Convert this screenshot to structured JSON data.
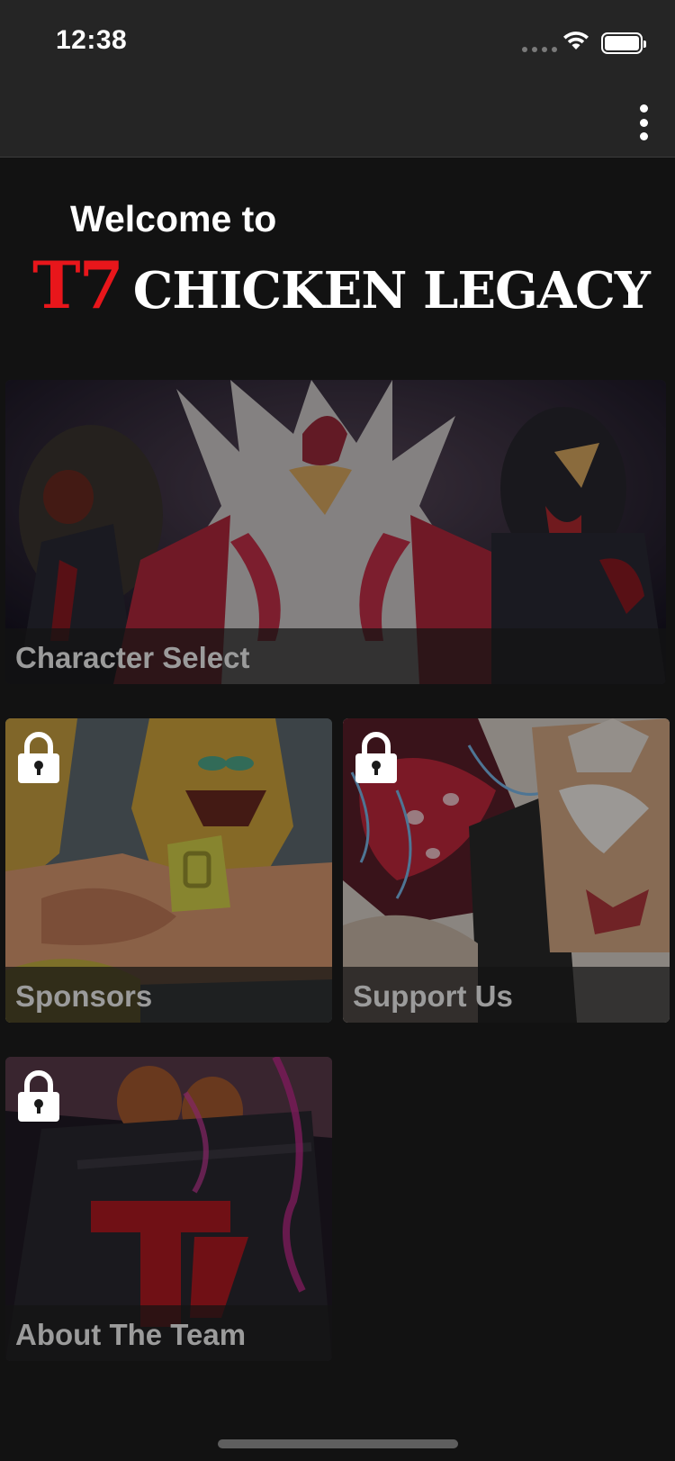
{
  "status_bar": {
    "time": "12:38",
    "signal_icon": "cellular-signal-icon",
    "wifi_icon": "wifi-icon",
    "battery_icon": "battery-icon"
  },
  "nav_bar": {
    "menu_icon": "more-vertical-icon"
  },
  "header": {
    "welcome": "Welcome to",
    "title_prefix": "T7",
    "title_main": "CHICKEN LEGACY"
  },
  "menu": {
    "character_select": {
      "label": "Character Select",
      "locked": false
    },
    "sponsors": {
      "label": "Sponsors",
      "locked": true
    },
    "support_us": {
      "label": "Support Us",
      "locked": true
    },
    "about_the_team": {
      "label": "About The Team",
      "locked": true
    }
  },
  "colors": {
    "background": "#121212",
    "bar": "#252525",
    "accent_red": "#e8161b",
    "label_text": "#9b9b9b"
  },
  "lock_icon": "lock-icon"
}
